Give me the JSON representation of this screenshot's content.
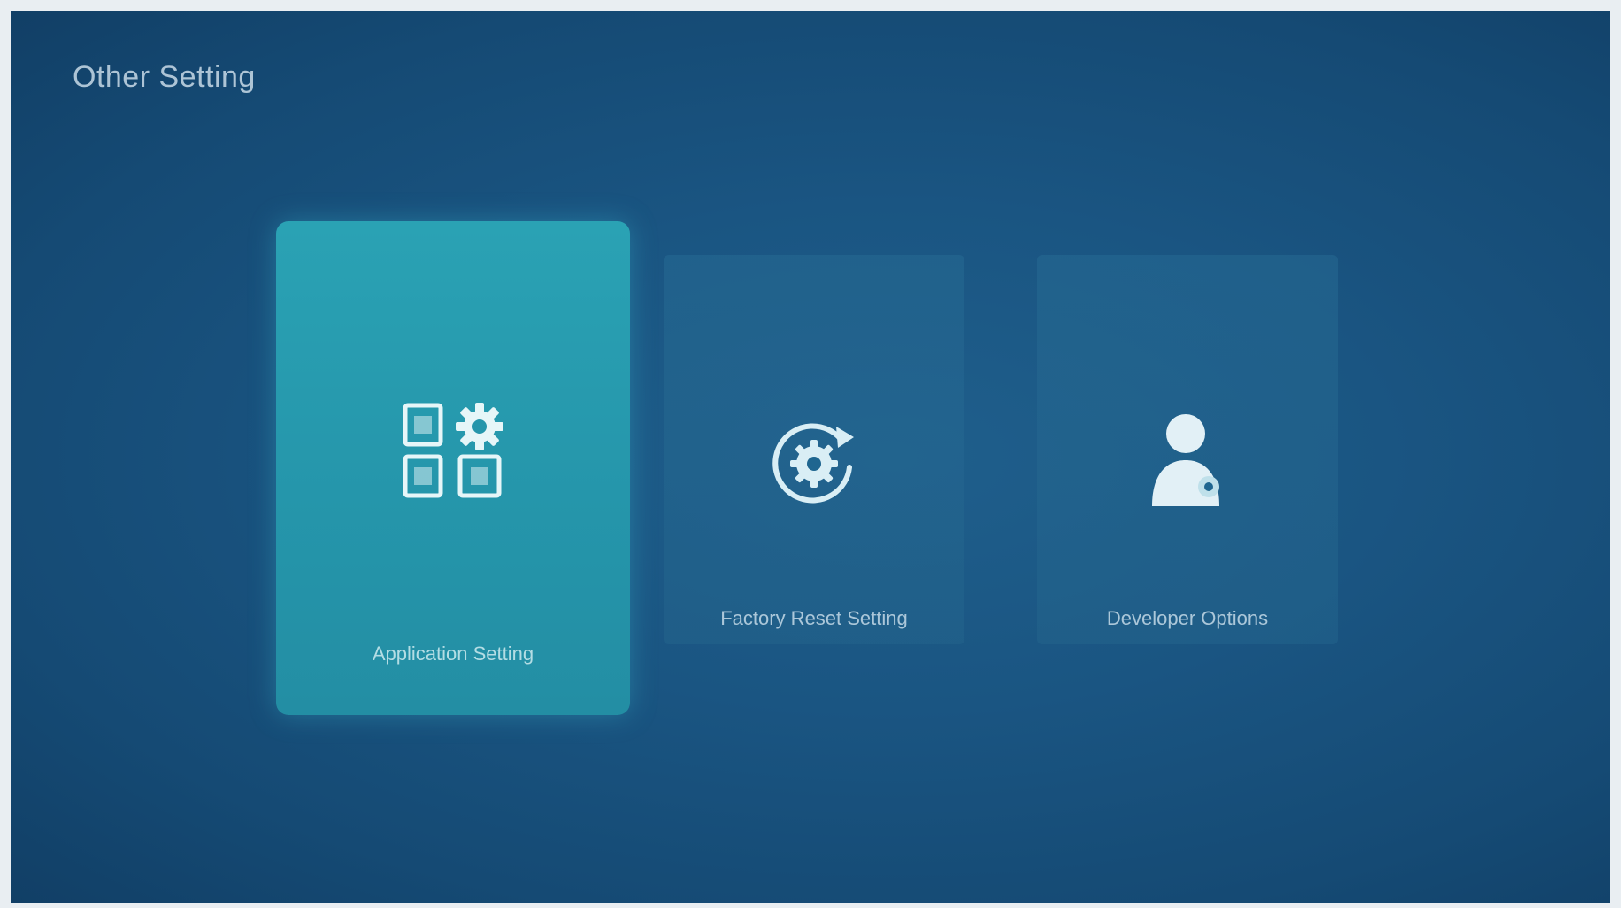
{
  "screen": {
    "title": "Other Setting"
  },
  "cards": [
    {
      "label": "Application Setting",
      "icon": "apps-gear-icon",
      "selected": true
    },
    {
      "label": "Factory Reset Setting",
      "icon": "factory-reset-icon",
      "selected": false
    },
    {
      "label": "Developer Options",
      "icon": "developer-person-icon",
      "selected": false
    }
  ],
  "colors": {
    "background": "#1a5582",
    "selected_card": "#2596ab",
    "text": "#cfe2ee"
  }
}
